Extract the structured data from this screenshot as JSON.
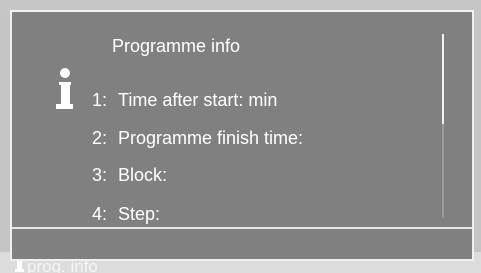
{
  "dialog": {
    "title": "Programme info",
    "rows": [
      {
        "number": "1:",
        "label": "Time after start:  min"
      },
      {
        "number": "2:",
        "label": "Programme finish time:"
      },
      {
        "number": "3:",
        "label": "Block:"
      },
      {
        "number": "4:",
        "label": "Step:"
      }
    ],
    "scrollbar": {
      "visible_fraction": 0.5,
      "position": 0
    }
  },
  "background": {
    "status_label": "prog. info"
  },
  "icons": {
    "dialog_info": "info-icon",
    "status_info": "info-icon"
  },
  "colors": {
    "dialog_bg": "#808080",
    "dialog_border": "#f0f0f0",
    "screen_bg": "#c5c5c5",
    "text": "#ffffff"
  }
}
